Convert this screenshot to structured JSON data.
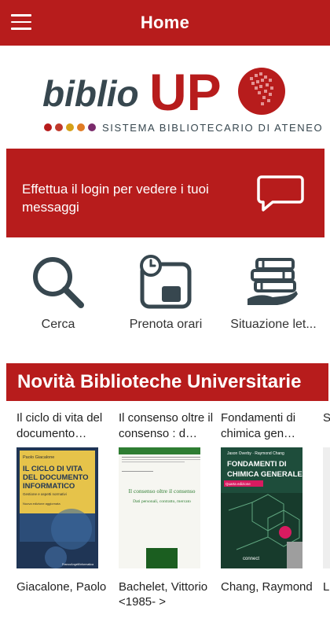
{
  "appbar": {
    "title": "Home",
    "menu_icon": "hamburger-menu-icon",
    "color": "#b71c1c"
  },
  "logo": {
    "word_left": "biblio",
    "word_right": "UP",
    "subtitle": "SISTEMA BIBLIOTECARIO DI ATENEO",
    "dot_colors": [
      "#b71c1c",
      "#c0392b",
      "#d4a017",
      "#e07b24",
      "#7a2a6b"
    ]
  },
  "banner": {
    "message": "Effettua il login per vedere i tuoi messaggi",
    "icon": "chat-bubble-icon"
  },
  "actions": [
    {
      "label": "Cerca",
      "icon": "search-icon"
    },
    {
      "label": "Prenota orari",
      "icon": "calendar-clock-icon"
    },
    {
      "label": "Situazione let...",
      "icon": "books-hand-icon"
    }
  ],
  "section": {
    "title": "Novità Biblioteche Universitarie"
  },
  "books": [
    {
      "title": "Il ciclo di vita del documento…",
      "author": "Giacalone, Paolo",
      "cover": {
        "author": "Paolo Giacalone",
        "l1": "IL CICLO DI VITA",
        "l2": "DEL DOCUMENTO",
        "l3": "INFORMATICO",
        "sub": "Gestione e aspetti normativi",
        "edition": "Nuova edizione aggiornata",
        "brand": "FrancoAngeli/Informatica"
      }
    },
    {
      "title": "Il consenso oltre il consenso : d…",
      "author": "Bachelet, Vittorio <1985- >",
      "cover": {
        "t1": "Il consenso oltre il consenso",
        "t2": "Dati personali, contratto, mercato"
      }
    },
    {
      "title": "Fondamenti di chimica gen…",
      "author": "Chang, Raymond",
      "cover": {
        "authors": "Jason Overby · Raymond Chang",
        "l1": "FONDAMENTI DI",
        "l2": "CHIMICA GENERALE",
        "edition": "Quarta edizione",
        "brand": "connect"
      }
    },
    {
      "title": "S…",
      "author": "L… F…"
    }
  ]
}
